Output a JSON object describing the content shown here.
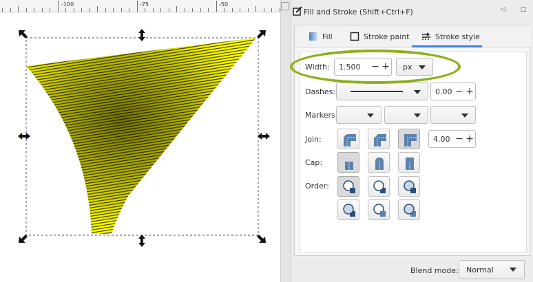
{
  "ruler": {
    "labels": [
      "-100",
      "-75",
      "-50"
    ]
  },
  "panel": {
    "title": "Fill and Stroke (Shift+Ctrl+F)",
    "tabs": [
      {
        "label": "Fill",
        "icon": "fill-icon"
      },
      {
        "label": "Stroke paint",
        "icon": "stroke-paint-icon"
      },
      {
        "label": "Stroke style",
        "icon": "stroke-style-icon",
        "active": true
      }
    ]
  },
  "stroke_style": {
    "width_label": "Width:",
    "width_value": "1.500",
    "unit": "px",
    "dashes_label": "Dashes:",
    "dash_offset": "0.00",
    "markers_label": "Markers:",
    "join_label": "Join:",
    "miter_limit": "4.00",
    "cap_label": "Cap:",
    "order_label": "Order:"
  },
  "blend": {
    "label": "Blend mode:",
    "value": "Normal"
  },
  "colors": {
    "accent": "#3584e4",
    "annotation": "#8db01a",
    "object_fill": "#ffff00"
  }
}
